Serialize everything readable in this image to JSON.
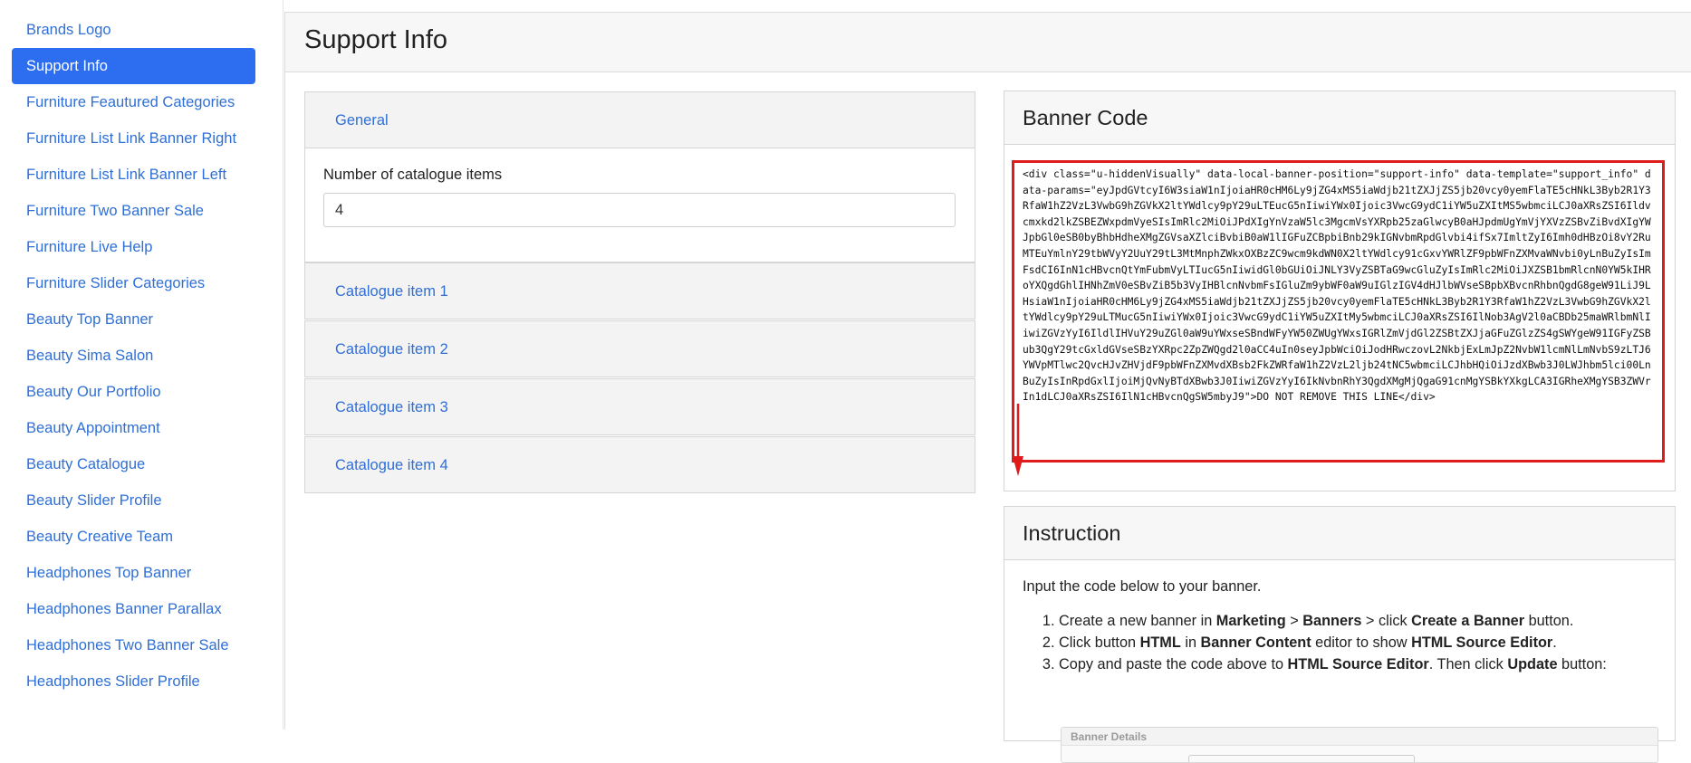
{
  "sidebar": {
    "items": [
      {
        "label": "Brands Logo",
        "active": false
      },
      {
        "label": "Support Info",
        "active": true
      },
      {
        "label": "Furniture Feautured Categories",
        "active": false
      },
      {
        "label": "Furniture List Link Banner Right",
        "active": false
      },
      {
        "label": "Furniture List Link Banner Left",
        "active": false
      },
      {
        "label": "Furniture Two Banner Sale",
        "active": false
      },
      {
        "label": "Furniture Live Help",
        "active": false
      },
      {
        "label": "Furniture Slider Categories",
        "active": false
      },
      {
        "label": "Beauty Top Banner",
        "active": false
      },
      {
        "label": "Beauty Sima Salon",
        "active": false
      },
      {
        "label": "Beauty Our Portfolio",
        "active": false
      },
      {
        "label": "Beauty Appointment",
        "active": false
      },
      {
        "label": "Beauty Catalogue",
        "active": false
      },
      {
        "label": "Beauty Slider Profile",
        "active": false
      },
      {
        "label": "Beauty Creative Team",
        "active": false
      },
      {
        "label": "Headphones Top Banner",
        "active": false
      },
      {
        "label": "Headphones Banner Parallax",
        "active": false
      },
      {
        "label": "Headphones Two Banner Sale",
        "active": false
      },
      {
        "label": "Headphones Slider Profile",
        "active": false
      }
    ]
  },
  "header": {
    "title": "Support Info"
  },
  "accordion": {
    "general_label": "General",
    "field_label": "Number of catalogue items",
    "field_value": "4",
    "items": [
      {
        "label": "Catalogue item 1"
      },
      {
        "label": "Catalogue item 2"
      },
      {
        "label": "Catalogue item 3"
      },
      {
        "label": "Catalogue item 4"
      }
    ]
  },
  "banner_code": {
    "title": "Banner Code",
    "code": "<div class=\"u-hiddenVisually\" data-local-banner-position=\"support-info\" data-template=\"support_info\" data-params=\"eyJpdGVtcyI6W3siaW1nIjoiaHR0cHM6Ly9jZG4xMS5iaWdjb21tZXJjZS5jb20vcy0yemFlaTE5cHNkL3Byb2R1Y3RfaW1hZ2VzL3VwbG9hZGVkX2ltYWdlcy9pY29uLTEucG5nIiwiYWx0Ijoic3VwcG9ydC1iYW5uZXItMS5wbmciLCJ0aXRsZSI6Ildvcmxkd2lkZSBEZWxpdmVyeSIsImRlc2MiOiJPdXIgYnVzaW5lc3MgcmVsYXRpb25zaGlwcyB0aHJpdmUgYmVjYXVzZSBvZiBvdXIgYWJpbGl0eSB0byBhbHdheXMgZGVsaXZlciBvbiB0aW1lIGFuZCBpbiBnb29kIGNvbmRpdGlvbi4ifSx7ImltZyI6Imh0dHBzOi8vY2RuMTEuYmlnY29tbWVyY2UuY29tL3MtMnphZWkxOXBzZC9wcm9kdWN0X2ltYWdlcy91cGxvYWRlZF9pbWFnZXMvaWNvbi0yLnBuZyIsImFsdCI6InN1cHBvcnQtYmFubmVyLTIucG5nIiwidGl0bGUiOiJNLY3VyZSBTaG9wcGluZyIsImRlc2MiOiJXZSB1bmRlcnN0YW5kIHRoYXQgdGhlIHNhZmV0eSBvZiB5b3VyIHBlcnNvbmFsIGluZm9ybWF0aW9uIGlzIGV4dHJlbWVseSBpbXBvcnRhbnQgdG8geW91LiJ9LHsiaW1nIjoiaHR0cHM6Ly9jZG4xMS5iaWdjb21tZXJjZS5jb20vcy0yemFlaTE5cHNkL3Byb2R1Y3RfaW1hZ2VzL3VwbG9hZGVkX2ltYWdlcy9pY29uLTMucG5nIiwiYWx0Ijoic3VwcG9ydC1iYW5uZXItMy5wbmciLCJ0aXRsZSI6IlNob3AgV2l0aCBDb25maWRlbmNlIiwiZGVzYyI6IldlIHVuY29uZGl0aW9uYWxseSBndWFyYW50ZWUgYWxsIGRlZmVjdGl2ZSBtZXJjaGFuZGlzZS4gSWYgeW91IGFyZSBub3QgY29tcGxldGVseSBzYXRpc2ZpZWQgd2l0aCC4uIn0seyJpbWciOiJodHRwczovL2NkbjExLmJpZ2NvbW1lcmNlLmNvbS9zLTJ6YWVpMTlwc2QvcHJvZHVjdF9pbWFnZXMvdXBsb2FkZWRfaW1hZ2VzL2ljb24tNC5wbmciLCJhbHQiOiJzdXBwb3J0LWJhbm5lci00LnBuZyIsInRpdGxlIjoiMjQvNyBTdXBwb3J0IiwiZGVzYyI6IkNvbnRhY3QgdXMgMjQgaG91cnMgYSBkYXkgLCA3IGRheXMgYSB3ZWVrIn1dLCJ0aXRsZSI6IlN1cHBvcnQgSW5mbyJ9\">DO NOT REMOVE THIS LINE</div>"
  },
  "instruction": {
    "title": "Instruction",
    "intro": "Input the code below to your banner.",
    "step1": {
      "a": "Create a new banner in ",
      "b": "Marketing",
      "c": " > ",
      "d": "Banners",
      "e": " > click ",
      "f": "Create a Banner",
      "g": " button."
    },
    "step2": {
      "a": "Click button ",
      "b": "HTML",
      "c": " in ",
      "d": "Banner Content",
      "e": " editor to show ",
      "f": "HTML Source Editor",
      "g": "."
    },
    "step3": {
      "a": "Copy and paste the code above to ",
      "b": "HTML Source Editor",
      "c": ". Then click ",
      "d": "Update",
      "e": " button:"
    },
    "thumbnail_title": "Banner Details"
  },
  "colors": {
    "accent": "#2d6ef0",
    "link": "#2f6fd6",
    "highlight": "#e01b1b"
  }
}
